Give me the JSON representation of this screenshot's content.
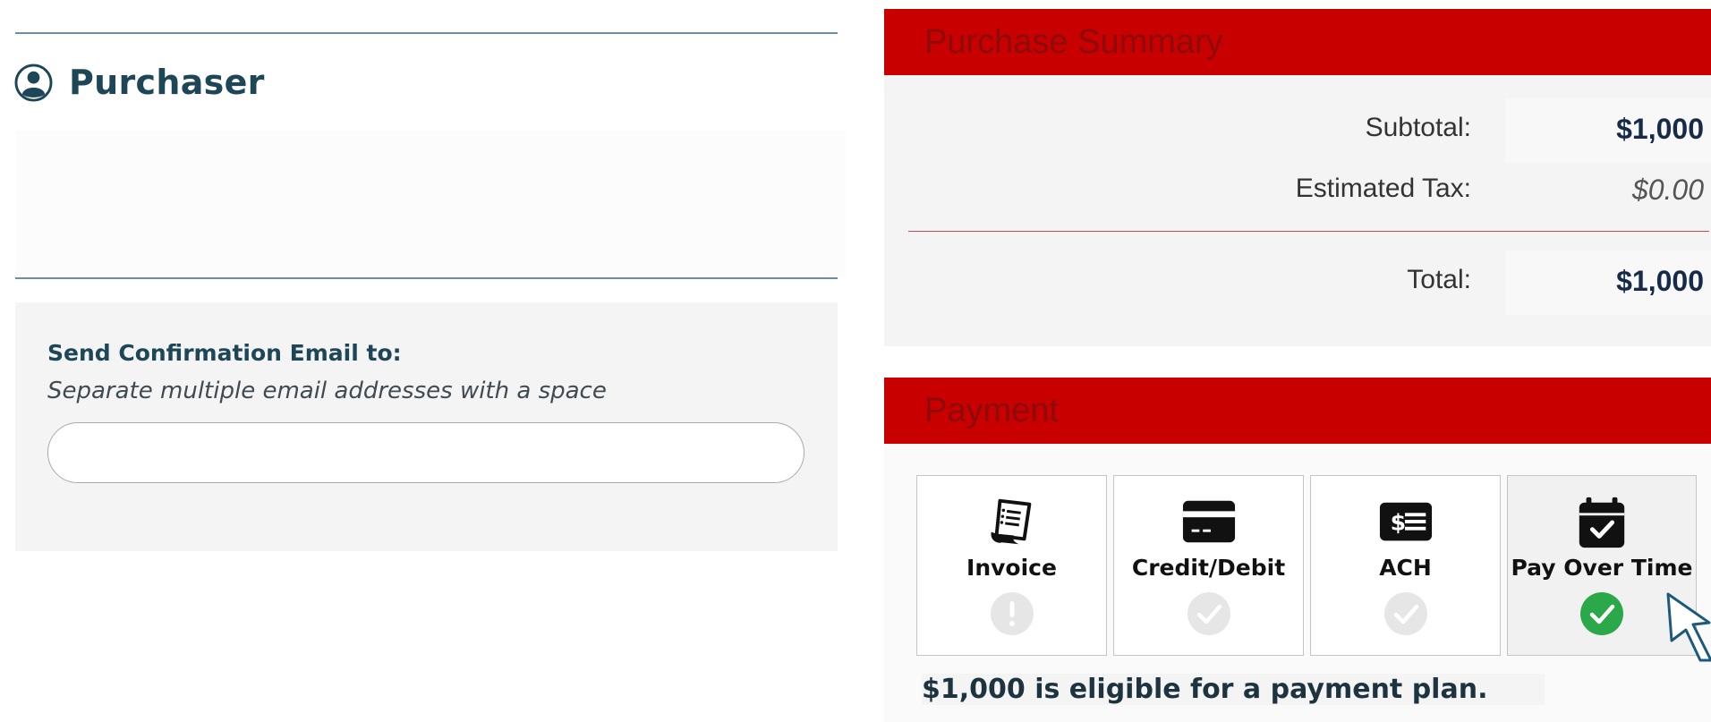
{
  "purchaser": {
    "title": "Purchaser",
    "icon": "person-circle-icon"
  },
  "confirmation_email": {
    "label": "Send Confirmation Email to:",
    "hint": "Separate multiple email addresses with a space",
    "value": "",
    "placeholder": ""
  },
  "summary": {
    "title": "Purchase Summary",
    "subtotal_label": "Subtotal:",
    "subtotal_value": "$1,000",
    "tax_label": "Estimated Tax:",
    "tax_value": "$0.00",
    "total_label": "Total:",
    "total_value": "$1,000"
  },
  "payment": {
    "title": "Payment",
    "methods": [
      {
        "label": "Invoice",
        "icon": "receipt-icon",
        "status": "exclamation-icon",
        "selected": false
      },
      {
        "label": "Credit/Debit",
        "icon": "credit-card-icon",
        "status": "check-icon",
        "selected": false
      },
      {
        "label": "ACH",
        "icon": "money-check-icon",
        "status": "check-icon",
        "selected": false
      },
      {
        "label": "Pay Over Time",
        "icon": "calendar-check-icon",
        "status": "check-icon",
        "selected": true
      }
    ],
    "eligibility_message": "$1,000 is eligible for a payment plan."
  },
  "colors": {
    "header_red": "#c80000",
    "header_text": "#8e0b0b",
    "heading_teal": "#1d4656",
    "success_green": "#2aa84a",
    "disabled_gray": "#e6e6e6"
  }
}
